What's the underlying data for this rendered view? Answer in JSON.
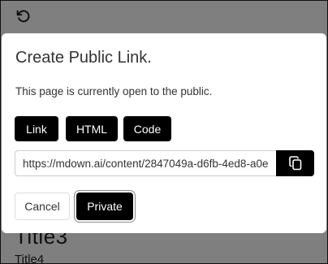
{
  "background": {
    "heading": "Title3",
    "subheading": "Title4"
  },
  "modal": {
    "title": "Create Public Link.",
    "description": "This page is currently open to the public.",
    "format_buttons": {
      "link": "Link",
      "html": "HTML",
      "code": "Code"
    },
    "link_value": "https://mdown.ai/content/2847049a-d6fb-4ed8-a0e",
    "cancel_label": "Cancel",
    "private_label": "Private"
  },
  "icons": {
    "undo": "undo-icon",
    "copy": "copy-icon"
  },
  "colors": {
    "button_bg": "#000000",
    "overlay": "rgba(0,0,0,0.5)"
  }
}
